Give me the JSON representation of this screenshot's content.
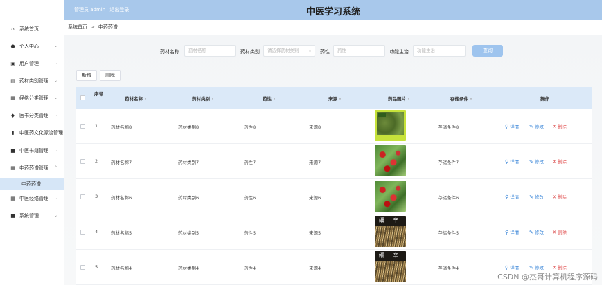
{
  "topbar": {
    "admin_role": "管理员 admin",
    "logout": "退出登录",
    "title": "中医学习系统"
  },
  "sidebar": {
    "items": [
      {
        "label": "系统首页",
        "icon": "home-icon",
        "has_chevron": false
      },
      {
        "label": "个人中心",
        "icon": "user-icon",
        "has_chevron": true
      },
      {
        "label": "用户管理",
        "icon": "users-icon",
        "has_chevron": true
      },
      {
        "label": "药材类别管理",
        "icon": "category-icon",
        "has_chevron": true
      },
      {
        "label": "经络分类管理",
        "icon": "grid-icon",
        "has_chevron": true
      },
      {
        "label": "医书分类管理",
        "icon": "location-icon",
        "has_chevron": true
      },
      {
        "label": "中医药文化源流管理",
        "icon": "chart-icon",
        "has_chevron": false
      },
      {
        "label": "中医书籍管理",
        "icon": "book-icon",
        "has_chevron": true
      },
      {
        "label": "中药药谱管理",
        "icon": "grid-icon",
        "has_chevron": true,
        "expanded": true
      },
      {
        "label": "中医经络管理",
        "icon": "grid-icon",
        "has_chevron": true
      },
      {
        "label": "系统管理",
        "icon": "settings-icon",
        "has_chevron": true
      }
    ],
    "active_sub": "中药药谱"
  },
  "breadcrumb": {
    "home": "系统首页",
    "separator": ">",
    "current": "中药药谱"
  },
  "search": {
    "name_label": "药材名称",
    "name_placeholder": "药材名称",
    "category_label": "药材类别",
    "category_placeholder": "请选择药材类别",
    "property_label": "药性",
    "property_placeholder": "药性",
    "function_label": "功能主治",
    "function_placeholder": "功能主治",
    "query_button": "查询"
  },
  "actions": {
    "add": "新增",
    "delete": "删除"
  },
  "table": {
    "headers": {
      "no": "序号",
      "name": "药材名称",
      "category": "药材类别",
      "property": "药性",
      "source": "来源",
      "image": "药品图片",
      "storage": "存储条件",
      "ops": "操作"
    },
    "rows": [
      {
        "no": "1",
        "name": "药材名称8",
        "category": "药材类别8",
        "property": "药性8",
        "source": "来源8",
        "image": "leaf",
        "storage": "存储条件8"
      },
      {
        "no": "2",
        "name": "药材名称7",
        "category": "药材类别7",
        "property": "药性7",
        "source": "来源7",
        "image": "berry",
        "storage": "存储条件7"
      },
      {
        "no": "3",
        "name": "药材名称6",
        "category": "药材类别6",
        "property": "药性6",
        "source": "来源6",
        "image": "berry",
        "storage": "存储条件6"
      },
      {
        "no": "4",
        "name": "药材名称5",
        "category": "药材类别5",
        "property": "药性5",
        "source": "来源5",
        "image": "root",
        "storage": "存储条件5"
      },
      {
        "no": "5",
        "name": "药材名称4",
        "category": "药材类别4",
        "property": "药性4",
        "source": "来源4",
        "image": "root",
        "storage": "存储条件4"
      }
    ],
    "image_caption_root": "细 辛",
    "op_detail": "详情",
    "op_edit": "修改",
    "op_delete": "删除"
  },
  "watermark": "CSDN @杰哥计算机程序源码",
  "colors": {
    "topbar": "#a8c8eb",
    "thead": "#dbe9f8",
    "query_button": "#9ec4ee",
    "link": "#2f7fd6",
    "danger": "#e04b4b"
  }
}
